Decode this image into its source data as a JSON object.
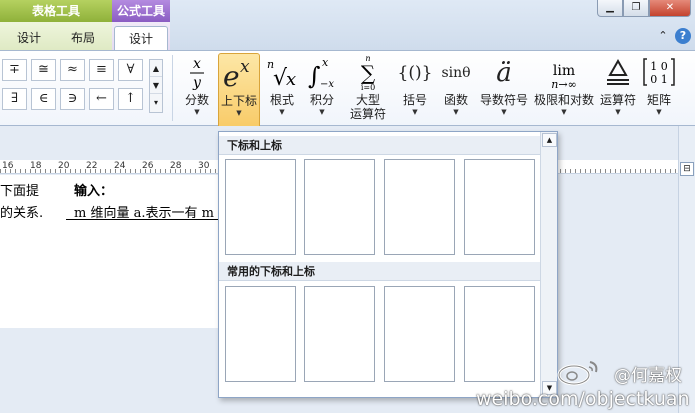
{
  "context_tabs": {
    "table_tools": "表格工具",
    "formula_tools": "公式工具"
  },
  "ribbon_tabs": [
    {
      "label": "设计"
    },
    {
      "label": "布局"
    },
    {
      "label": "设计"
    }
  ],
  "symbols": [
    "∓",
    "≅",
    "≈",
    "≡",
    "∀",
    "∃",
    "∈",
    "∋",
    "←",
    "↑"
  ],
  "buttons": [
    {
      "label": "分数",
      "icon": "fraction-icon"
    },
    {
      "label": "上下标",
      "icon": "script-icon"
    },
    {
      "label": "根式",
      "icon": "radical-icon"
    },
    {
      "label": "积分",
      "icon": "integral-icon"
    },
    {
      "label": "大型",
      "label2": "运算符",
      "icon": "large-operator-icon"
    },
    {
      "label": "括号",
      "icon": "bracket-icon",
      "glyph": "{()}"
    },
    {
      "label": "函数",
      "icon": "function-icon",
      "glyph": "sinθ"
    },
    {
      "label": "导数符号",
      "icon": "accent-icon",
      "glyph": "ä"
    },
    {
      "label": "极限和对数",
      "icon": "limit-log-icon"
    },
    {
      "label": "运算符",
      "icon": "operator-icon"
    },
    {
      "label": "矩阵",
      "icon": "matrix-icon"
    }
  ],
  "ruler_numbers": [
    "16",
    "18",
    "20",
    "22",
    "24",
    "26",
    "28",
    "30"
  ],
  "document": {
    "line1_left": "下面提",
    "line1_right": "输入：",
    "line2_left": "的关系.",
    "line2_right": "m 维向量 a.表示一有 m"
  },
  "gallery": {
    "section1": "下标和上标",
    "section2": "常用的下标和上标"
  },
  "watermark": {
    "user": "@何嘉权",
    "url": "weibo.com/objectkuan"
  },
  "colors": {
    "table_tools": "#9fbf4a",
    "formula_tools": "#9a6ccf",
    "active_button": "#f9cf6d"
  }
}
